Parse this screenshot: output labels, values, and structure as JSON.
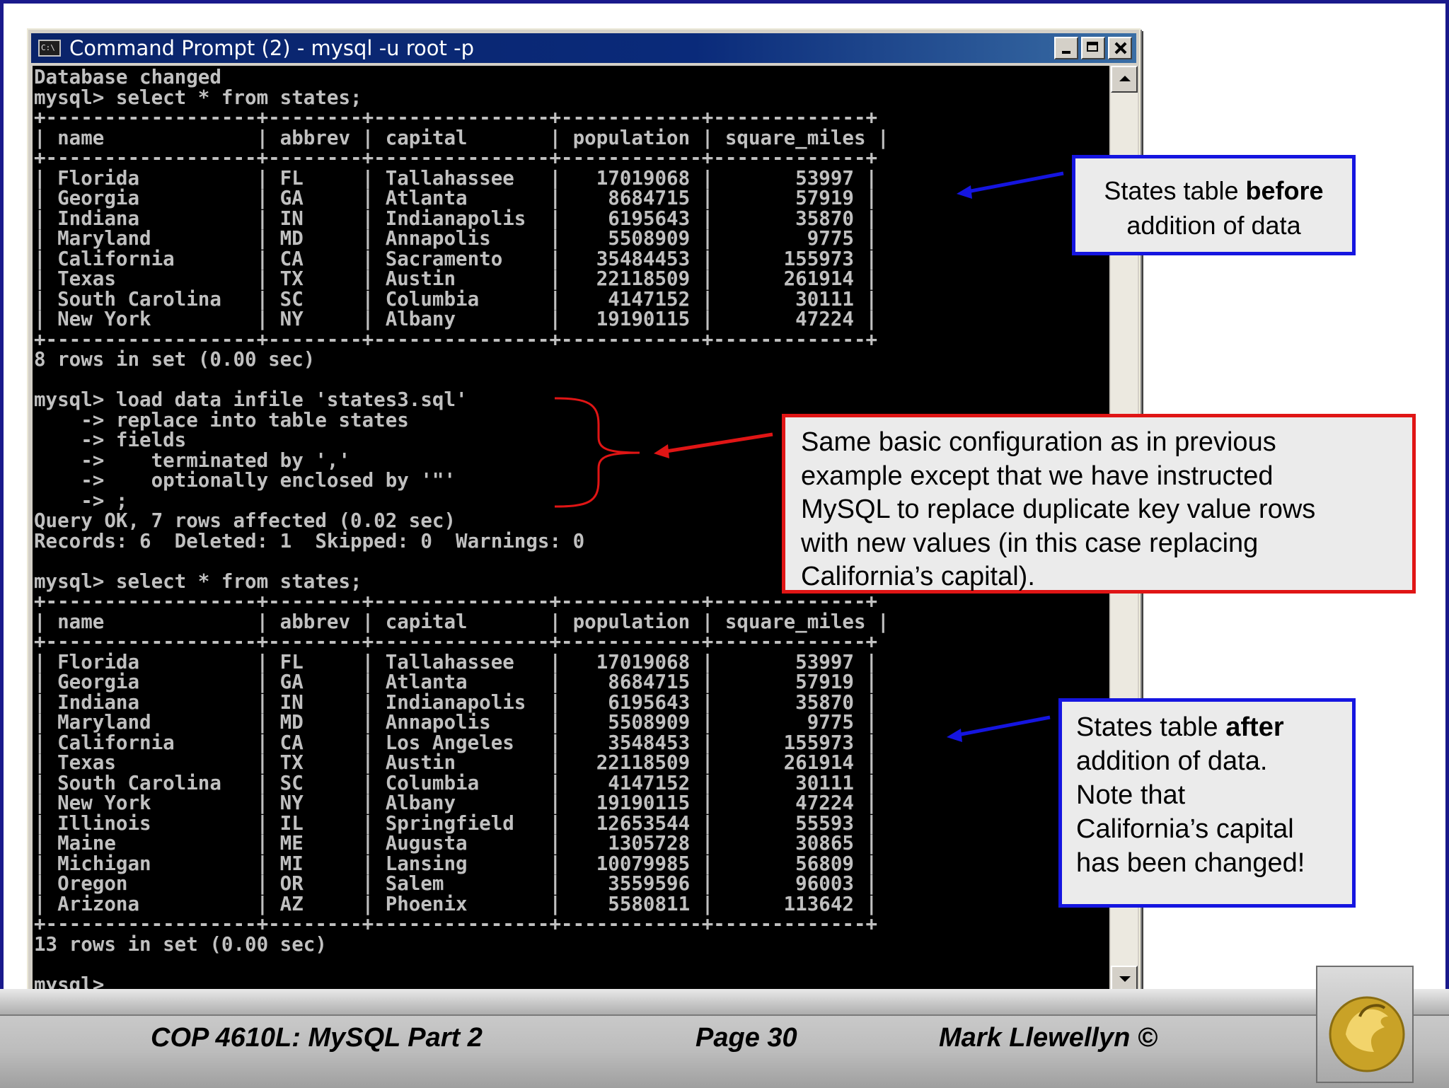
{
  "window": {
    "title": "Command Prompt (2) - mysql -u root -p",
    "icon_text": "C:\\"
  },
  "console": {
    "lines": [
      "Database changed",
      "mysql> select * from states;",
      "+------------------+--------+---------------+------------+-------------+",
      "| name             | abbrev | capital       | population | square_miles |",
      "+------------------+--------+---------------+------------+-------------+",
      "| Florida          | FL     | Tallahassee   |   17019068 |       53997 |",
      "| Georgia          | GA     | Atlanta       |    8684715 |       57919 |",
      "| Indiana          | IN     | Indianapolis  |    6195643 |       35870 |",
      "| Maryland         | MD     | Annapolis     |    5508909 |        9775 |",
      "| California       | CA     | Sacramento    |   35484453 |      155973 |",
      "| Texas            | TX     | Austin        |   22118509 |      261914 |",
      "| South Carolina   | SC     | Columbia      |    4147152 |       30111 |",
      "| New York         | NY     | Albany        |   19190115 |       47224 |",
      "+------------------+--------+---------------+------------+-------------+",
      "8 rows in set (0.00 sec)",
      "",
      "mysql> load data infile 'states3.sql'",
      "    -> replace into table states",
      "    -> fields",
      "    ->    terminated by ','",
      "    ->    optionally enclosed by '\"'",
      "    -> ;",
      "Query OK, 7 rows affected (0.02 sec)",
      "Records: 6  Deleted: 1  Skipped: 0  Warnings: 0",
      "",
      "mysql> select * from states;",
      "+------------------+--------+---------------+------------+-------------+",
      "| name             | abbrev | capital       | population | square_miles |",
      "+------------------+--------+---------------+------------+-------------+",
      "| Florida          | FL     | Tallahassee   |   17019068 |       53997 |",
      "| Georgia          | GA     | Atlanta       |    8684715 |       57919 |",
      "| Indiana          | IN     | Indianapolis  |    6195643 |       35870 |",
      "| Maryland         | MD     | Annapolis     |    5508909 |        9775 |",
      "| California       | CA     | Los Angeles   |    3548453 |      155973 |",
      "| Texas            | TX     | Austin        |   22118509 |      261914 |",
      "| South Carolina   | SC     | Columbia      |    4147152 |       30111 |",
      "| New York         | NY     | Albany        |   19190115 |       47224 |",
      "| Illinois         | IL     | Springfield   |   12653544 |       55593 |",
      "| Maine            | ME     | Augusta       |    1305728 |       30865 |",
      "| Michigan         | MI     | Lansing       |   10079985 |       56809 |",
      "| Oregon           | OR     | Salem         |    3559596 |       96003 |",
      "| Arizona          | AZ     | Phoenix       |    5580811 |      113642 |",
      "+------------------+--------+---------------+------------+-------------+",
      "13 rows in set (0.00 sec)",
      "",
      "mysql> "
    ]
  },
  "callouts": {
    "before": {
      "line1_pre": "States table ",
      "line1_bold": "before",
      "line2": "addition of data"
    },
    "same_config": {
      "lines": [
        "Same basic configuration as in previous",
        "example except that we have instructed",
        "MySQL to replace duplicate key value rows",
        "with new values (in this case replacing",
        "California’s capital)."
      ]
    },
    "after": {
      "line1_pre": "States table ",
      "line1_bold": "after",
      "lines": [
        "addition of data.",
        "Note that",
        "California’s capital",
        "has been changed!"
      ]
    }
  },
  "footer": {
    "course": "COP 4610L: MySQL Part 2",
    "page": "Page 30",
    "author": "Mark Llewellyn ©"
  },
  "colors": {
    "blue_callout": "#1515e0",
    "red_callout": "#e01515",
    "console_bg": "#000000",
    "console_text": "#c0c0c0",
    "title_bar": "#0a246a"
  },
  "icons": [
    "cmd-icon",
    "minimize-icon",
    "maximize-icon",
    "close-icon",
    "scroll-up-icon",
    "scroll-down-icon",
    "ucf-pegasus-logo"
  ]
}
